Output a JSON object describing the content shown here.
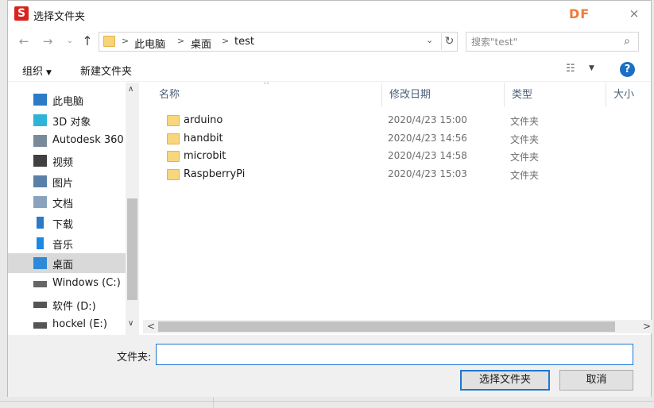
{
  "window": {
    "title": "选择文件夹",
    "logo_text": "S",
    "watermark": "DF",
    "close_glyph": "×"
  },
  "navigation": {
    "back_glyph": "←",
    "forward_glyph": "→",
    "recent_glyph": "⌄",
    "up_glyph": "↑",
    "breadcrumbs": [
      "此电脑",
      "桌面",
      "test"
    ],
    "dropdown_glyph": "⌄",
    "refresh_glyph": "↻",
    "search": {
      "placeholder": "搜索\"test\"",
      "icon": "search-icon"
    }
  },
  "toolbar": {
    "organize_label": "组织",
    "organize_arrow": "▼",
    "new_folder_label": "新建文件夹",
    "view_glyph": "☷",
    "view_arrow": "▼",
    "help_glyph": "?"
  },
  "nav_pane": {
    "items": [
      {
        "label": "此电脑",
        "icon": "computer-icon",
        "color": "#2b7bc6",
        "selected": false
      },
      {
        "label": "3D 对象",
        "icon": "cube-icon",
        "color": "#2fb4d8",
        "selected": false
      },
      {
        "label": "Autodesk 360",
        "icon": "cloud-icon",
        "color": "#7a8a99",
        "selected": false
      },
      {
        "label": "视频",
        "icon": "video-icon",
        "color": "#404040",
        "selected": false
      },
      {
        "label": "图片",
        "icon": "pictures-icon",
        "color": "#5a7fa8",
        "selected": false
      },
      {
        "label": "文档",
        "icon": "documents-icon",
        "color": "#8aa3bd",
        "selected": false
      },
      {
        "label": "下载",
        "icon": "download-icon",
        "color": "#2e78c8",
        "selected": false
      },
      {
        "label": "音乐",
        "icon": "music-icon",
        "color": "#1e88e5",
        "selected": false
      },
      {
        "label": "桌面",
        "icon": "desktop-icon",
        "color": "#2e8ad8",
        "selected": true
      },
      {
        "label": "Windows (C:)",
        "icon": "windows-drive-icon",
        "color": "#666666",
        "selected": false
      },
      {
        "label": "软件 (D:)",
        "icon": "drive-icon",
        "color": "#555555",
        "selected": false
      },
      {
        "label": "hockel (E:)",
        "icon": "drive-icon",
        "color": "#555555",
        "selected": false
      }
    ],
    "scroll_up_glyph": "∧",
    "scroll_down_glyph": "∨"
  },
  "file_list": {
    "sort_glyph": "^",
    "columns": {
      "name": "名称",
      "date": "修改日期",
      "type": "类型",
      "size": "大小"
    },
    "rows": [
      {
        "name": "arduino",
        "date": "2020/4/23 15:00",
        "type": "文件夹"
      },
      {
        "name": "handbit",
        "date": "2020/4/23 14:56",
        "type": "文件夹"
      },
      {
        "name": "microbit",
        "date": "2020/4/23 14:58",
        "type": "文件夹"
      },
      {
        "name": "RaspberryPi",
        "date": "2020/4/23 15:03",
        "type": "文件夹"
      }
    ],
    "scroll_left_glyph": "<",
    "scroll_right_glyph": ">"
  },
  "footer": {
    "folder_label": "文件夹:",
    "folder_value": "",
    "select_button": "选择文件夹",
    "cancel_button": "取消"
  },
  "colors": {
    "accent": "#1d78d0",
    "folder": "#f8d77c",
    "header_text": "#4c607a",
    "selection": "#d9d9d9"
  }
}
